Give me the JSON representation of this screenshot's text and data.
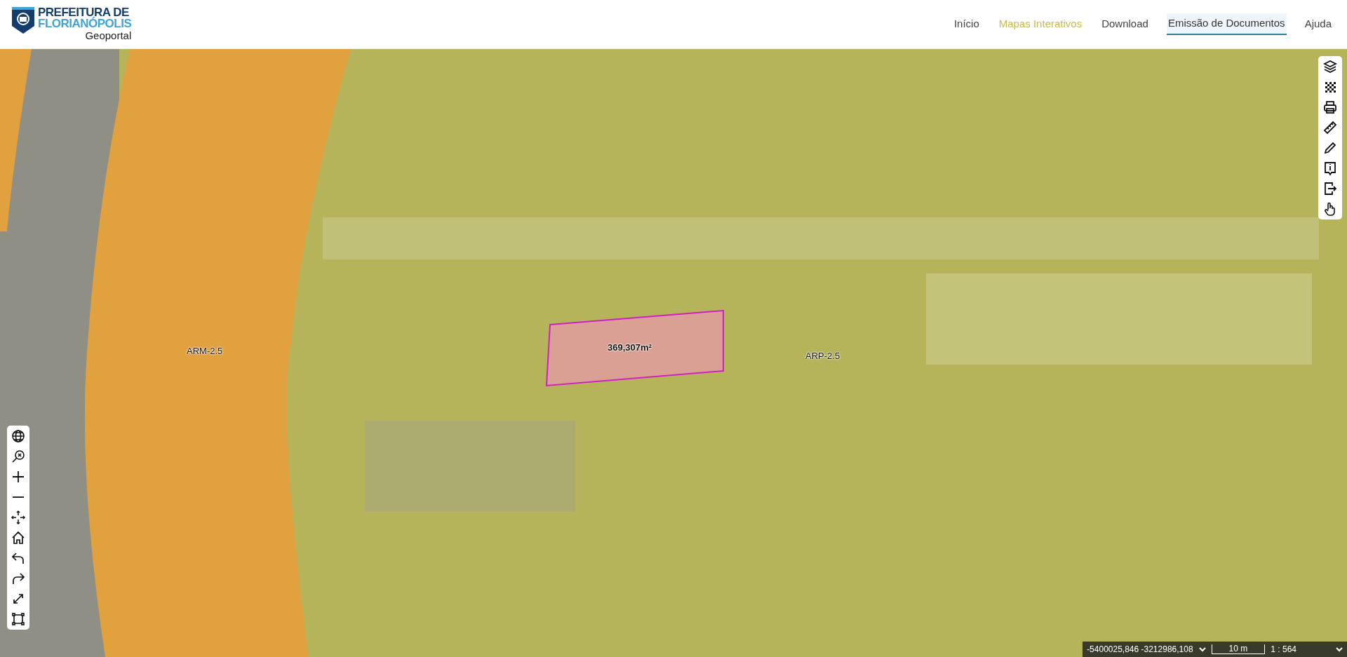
{
  "header": {
    "logo_line_1": "PREFEITURA DE",
    "logo_line_2": "FLORIANÓPOLIS",
    "subtitle": "Geoportal"
  },
  "nav": [
    {
      "label": "Início",
      "selected": false,
      "highlighted": false
    },
    {
      "label": "Mapas Interativos",
      "selected": false,
      "highlighted": true
    },
    {
      "label": "Download",
      "selected": false,
      "highlighted": false
    },
    {
      "label": "Emissão de Documentos",
      "selected": true,
      "highlighted": false
    },
    {
      "label": "Ajuda",
      "selected": false,
      "highlighted": false
    }
  ],
  "map": {
    "zone_labels": [
      {
        "label": "ARM-2.5"
      },
      {
        "label": "ARP-2.5"
      }
    ],
    "parcel": {
      "area": "369,307m²"
    }
  },
  "status_bar": {
    "coordinates": "-5400025,846 -3212986,108",
    "scale_bar": "10 m",
    "scale_ratio": "1 : 564"
  }
}
